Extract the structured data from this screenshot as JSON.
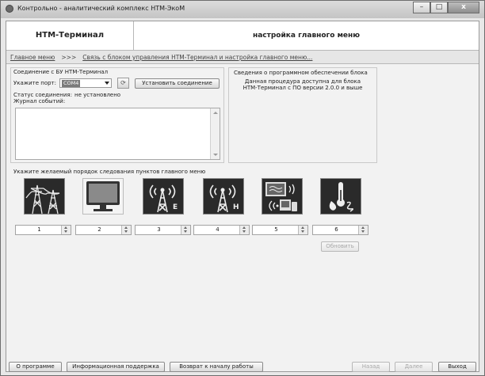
{
  "window": {
    "title": "Контрольно - аналитический комплекс НТМ-ЭкоМ",
    "minimize": "–",
    "maximize": "□",
    "close": "x"
  },
  "header": {
    "left_title": "НТМ-Терминал",
    "right_title": "настройка главного меню"
  },
  "breadcrumb": {
    "home": "Главное меню",
    "sep": ">>>",
    "current": "Связь с блоком управления НТМ-Терминал и настройка главного меню..."
  },
  "connection": {
    "title": "Соединение с БУ НТМ-Терминал",
    "port_label": "Укажите порт:",
    "port_value": "COM4",
    "connect_button": "Установить соединение",
    "status_label": "Статус соединения:",
    "status_value": "не установлено",
    "log_label": "Журнал событий:"
  },
  "software_info": {
    "title": "Сведения о программном обеспечении блока",
    "line1": "Данная процедура доступна для блока",
    "line2": "НТМ-Терминал с ПО версии 2.0.0 и выше"
  },
  "menu_order": {
    "label": "Укажите желаемый порядок следования пунктов главного меню",
    "items": [
      {
        "icon": "power-lines-icon",
        "value": "1"
      },
      {
        "icon": "monitor-icon",
        "value": "2"
      },
      {
        "icon": "radio-tower-e-icon",
        "value": "3"
      },
      {
        "icon": "radio-tower-h-icon",
        "value": "4"
      },
      {
        "icon": "devices-wireless-icon",
        "value": "5"
      },
      {
        "icon": "thermometer-drop-icon",
        "value": "6"
      }
    ],
    "refresh_button": "Обновить"
  },
  "footer": {
    "about": "О программе",
    "support": "Информационная поддержка",
    "back_start": "Возврат к началу работы",
    "back": "Назад",
    "next": "Далее",
    "exit": "Выход"
  }
}
